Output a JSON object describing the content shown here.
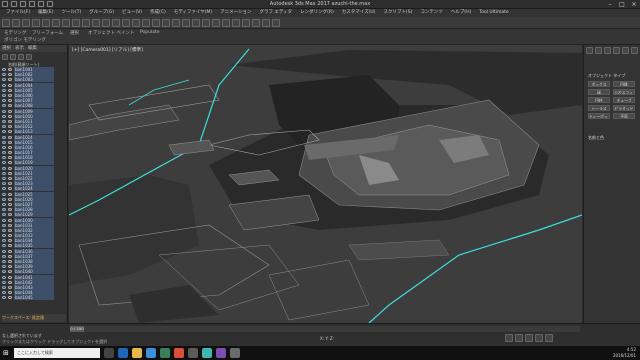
{
  "window": {
    "title": "Autodesk 3ds Max 2017    azuchi-the.max"
  },
  "menu": {
    "items": [
      "ファイル(F)",
      "編集(E)",
      "ツール(T)",
      "グループ(G)",
      "ビュー(V)",
      "作成(C)",
      "モディファイヤ(M)",
      "アニメーション",
      "グラフ エディタ",
      "レンダリング(R)",
      "カスタマイズ(U)",
      "スクリプト(S)",
      "コンテンツ",
      "ヘルプ(H)",
      "Tool Ultimate"
    ]
  },
  "ribbon": {
    "tabs": [
      "モデリング",
      "フリーフォーム",
      "選択",
      "オブジェクト ペイント",
      "Populate"
    ],
    "sub": "ポリゴン モデリング"
  },
  "scene_explorer": {
    "tabs": [
      "選択",
      "表示",
      "編集"
    ],
    "header": "名前(昇順ソート)",
    "items": [
      "ban1001",
      "ban1002",
      "ban1003",
      "ban1004",
      "ban1005",
      "ban1006",
      "ban1007",
      "ban1008",
      "ban1009",
      "ban1010",
      "ban1011",
      "ban1012",
      "ban1013",
      "ban1014",
      "ban1015",
      "ban1016",
      "ban1017",
      "ban1018",
      "ban1019",
      "ban1020",
      "ban1021",
      "ban1022",
      "ban1023",
      "ban1024",
      "ban1025",
      "ban1026",
      "ban1027",
      "ban1028",
      "ban1029",
      "ban1030",
      "ban1031",
      "ban1032",
      "ban1033",
      "ban1034",
      "ban1035",
      "ban1036",
      "ban1037",
      "ban1038",
      "ban1039",
      "ban1040",
      "ban1041",
      "ban1042",
      "ban1043",
      "ban1044",
      "ban1045"
    ],
    "footer": "ワークスペース: 既定値"
  },
  "viewport": {
    "label": "[+] [Camera001] [リアル] [標準]"
  },
  "command_panel": {
    "section1": "オブジェクト タイプ",
    "buttons": [
      "ボックス",
      "円錐",
      "球",
      "ジオスフィア",
      "円柱",
      "チューブ",
      "トーラス",
      "ピラミッド",
      "ティーポット",
      "平面"
    ],
    "section2": "名前と色"
  },
  "timeline": {
    "frame": "0 / 100",
    "status": "なし選択されています",
    "hint": "クリックまたはクリック ドラッグしてオブジェクトを選択",
    "coords": "X: Y: Z:"
  },
  "taskbar": {
    "search": "ここに入力して検索",
    "time": "4:52",
    "date": "2016/12/01"
  },
  "colors": {
    "accent": "#3d9fd6",
    "path": "#3ce0d8",
    "panel": "#313131"
  }
}
